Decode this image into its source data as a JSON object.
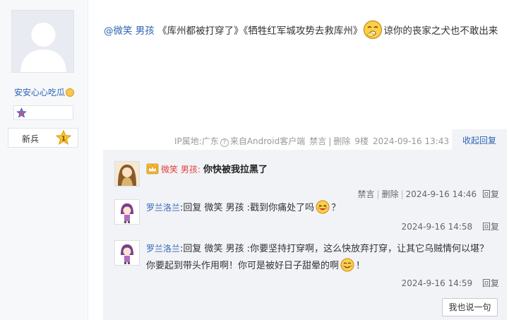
{
  "author": {
    "name": "安安心心吃瓜",
    "level_label": "新兵",
    "level_number": "1"
  },
  "post": {
    "mention": "@微笑 男孩",
    "text_part1": " 《库州都被打穿了》《牺牲红军城攻势去救库州》",
    "text_part2": "谅你的丧家之犬也不敢出来"
  },
  "post_meta": {
    "ip": "IP属地:广东",
    "client": "来自Android客户端",
    "ban": "禁言",
    "delete": "删除",
    "floor": "9楼",
    "time": "2024-09-16 13:43",
    "collapse": "收起回复"
  },
  "replies": [
    {
      "name": "微笑 男孩:",
      "text": "你快被我拉黑了",
      "ban": "禁言",
      "delete": "删除",
      "time": "2024-9-16 14:46",
      "reply": "回复"
    },
    {
      "name": "罗兰洛兰",
      "text_a": ":回复 微笑 男孩 :戳到你痛处了吗",
      "text_b": "？",
      "time": "2024-9-16 14:58",
      "reply": "回复"
    },
    {
      "name": "罗兰洛兰",
      "text_a": ":回复 微笑 男孩 :你要坚持打穿啊，这么快放弃打穿，让其它乌贼情何以堪？你要起到带头作用啊！你可是被好日子甜晕的啊",
      "text_b": "！",
      "time": "2024-9-16 14:59",
      "reply": "回复"
    }
  ],
  "say_button": "我也说一句",
  "colors": {
    "link": "#2d64b3",
    "red_name": "#e0413b",
    "panel_bg": "#f2f3f7"
  }
}
